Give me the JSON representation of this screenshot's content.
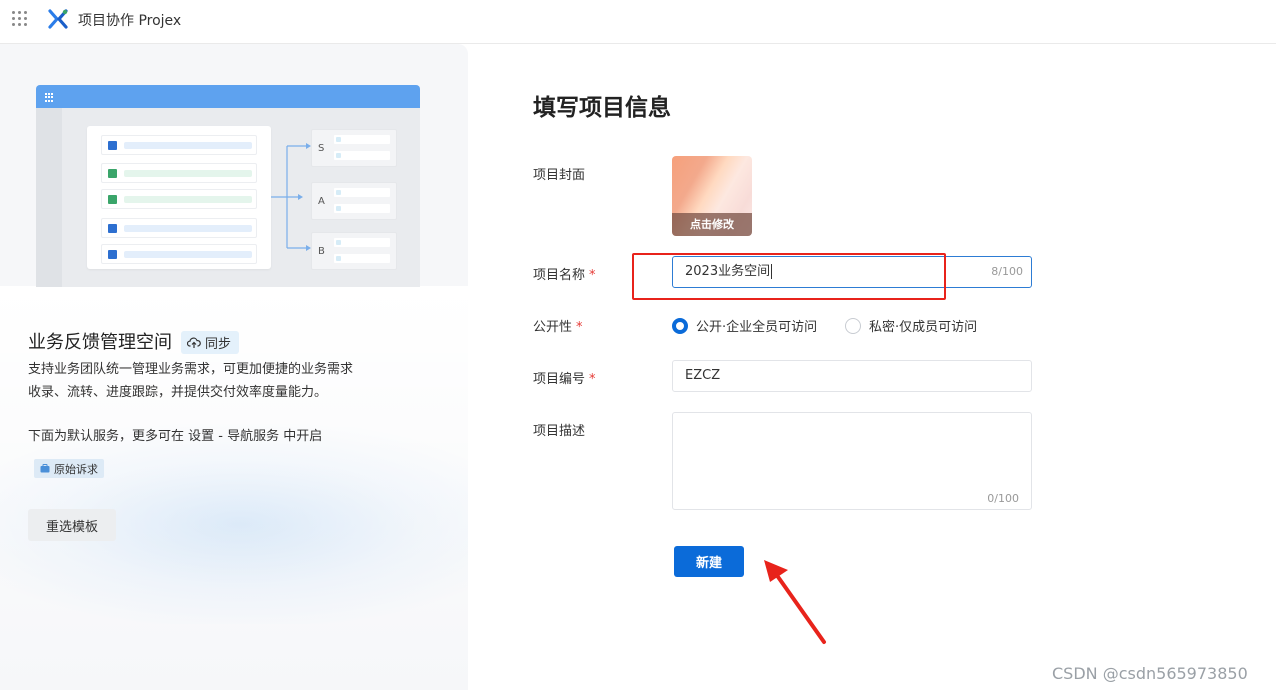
{
  "header": {
    "app_title": "项目协作 Projex",
    "grid_icon": "apps-grid-icon",
    "logo_icon": "projex-logo-icon"
  },
  "template_panel": {
    "illustration": {
      "branch_labels": [
        "S",
        "A",
        "B"
      ],
      "row_colors": [
        "#2d6fd0",
        "#3aa56a",
        "#3aa56a",
        "#2d6fd0",
        "#2d6fd0"
      ]
    },
    "project_title": "业务反馈管理空间",
    "sync_badge": {
      "label": "同步",
      "icon": "cloud-sync-icon"
    },
    "description_line1": "支持业务团队统一管理业务需求，可更加便捷的业务需求",
    "description_line2": "收录、流转、进度跟踪，并提供交付效率度量能力。",
    "services_note": "下面为默认服务，更多可在 设置 - 导航服务 中开启",
    "service_tag": {
      "label": "原始诉求",
      "icon": "briefcase-icon"
    },
    "reselect_button": "重选模板"
  },
  "form": {
    "title": "填写项目信息",
    "cover": {
      "label": "项目封面",
      "action": "点击修改"
    },
    "name": {
      "label": "项目名称",
      "required": "*",
      "value": "2023业务空间",
      "counter": "8/100"
    },
    "visibility": {
      "label": "公开性",
      "required": "*",
      "options": [
        "公开·企业全员可访问",
        "私密·仅成员可访问"
      ],
      "selected": "公开·企业全员可访问"
    },
    "code": {
      "label": "项目编号",
      "required": "*",
      "value": "EZCZ"
    },
    "description": {
      "label": "项目描述",
      "counter": "0/100"
    },
    "submit_button": "新建"
  },
  "annotations": {
    "highlight_color": "#e8231b"
  },
  "watermark": "CSDN @csdn565973850",
  "colors": {
    "primary": "#0b6bd9",
    "accent_blue": "#5ea2ef",
    "required": "#e53935"
  }
}
